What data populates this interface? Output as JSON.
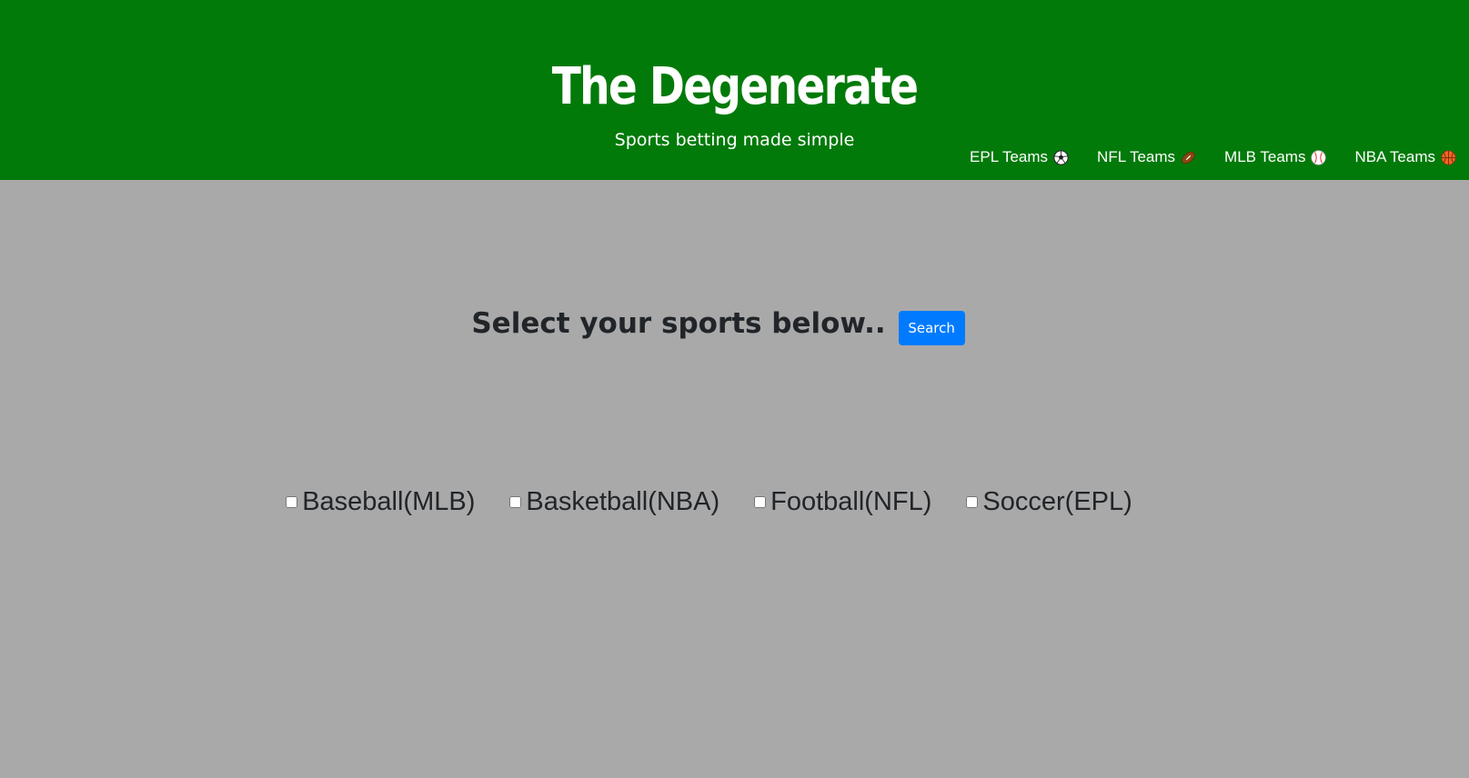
{
  "header": {
    "title": "The Degenerate",
    "tagline": "Sports betting made simple",
    "background_color": "#027a0a",
    "nav": [
      {
        "label": "EPL Teams",
        "icon": "soccer-ball-icon"
      },
      {
        "label": "NFL Teams",
        "icon": "football-icon"
      },
      {
        "label": "MLB Teams",
        "icon": "baseball-icon"
      },
      {
        "label": "NBA Teams",
        "icon": "basketball-icon"
      }
    ]
  },
  "main": {
    "heading": "Select your sports below..",
    "search_label": "Search",
    "search_color": "#007bff",
    "background_color": "#a9a9a9",
    "sports": [
      {
        "label": "Baseball(MLB)",
        "checked": false
      },
      {
        "label": "Basketball(NBA)",
        "checked": false
      },
      {
        "label": "Football(NFL)",
        "checked": false
      },
      {
        "label": "Soccer(EPL)",
        "checked": false
      }
    ]
  }
}
